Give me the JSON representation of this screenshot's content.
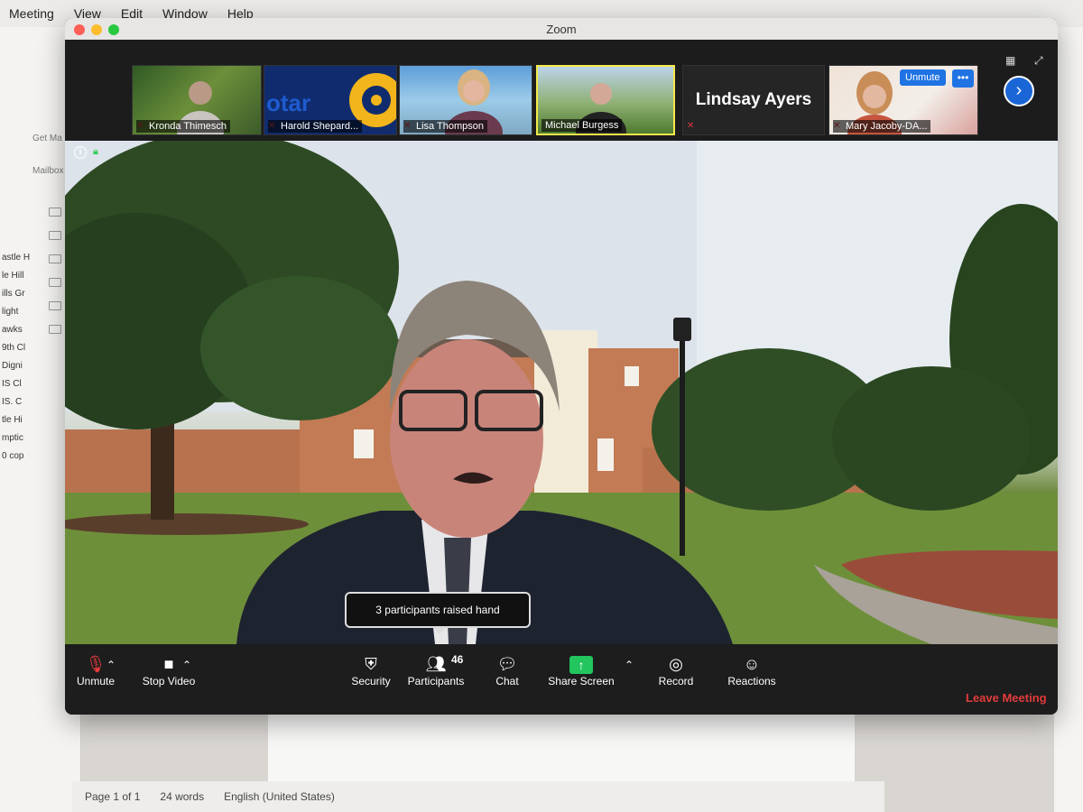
{
  "menubar": {
    "items": [
      "Meeting",
      "View",
      "Edit",
      "Window",
      "Help"
    ]
  },
  "window": {
    "title": "Zoom"
  },
  "participants": [
    {
      "name": "Kronda Thimesch"
    },
    {
      "name": "Harold Shepard..."
    },
    {
      "name": "Lisa Thompson"
    },
    {
      "name": "Michael Burgess"
    },
    {
      "name": "Lindsay Ayers"
    },
    {
      "name": "Mary Jacoby-DA..."
    }
  ],
  "thumb_actions": {
    "unmute": "Unmute",
    "more": "•••"
  },
  "tooltip": {
    "text": "3 participants raised hand"
  },
  "toolbar": {
    "unmute": "Unmute",
    "stop_video": "Stop Video",
    "security": "Security",
    "participants": "Participants",
    "participants_count": "46",
    "chat": "Chat",
    "share_screen": "Share Screen",
    "record": "Record",
    "reactions": "Reactions",
    "leave": "Leave Meeting"
  },
  "mail": {
    "get_mail": "Get Ma",
    "mailbox": "Mailbox",
    "rows": [
      "astle H",
      "le Hill",
      "ills Gr",
      "light",
      "awks",
      "9th Cl",
      "Digni",
      "IS Cl",
      "IS. C",
      "tle Hi",
      "mptic",
      "0 cop"
    ]
  },
  "word_status": {
    "page": "Page 1 of 1",
    "words": "24 words",
    "language": "English (United States)"
  },
  "colors": {
    "accent": "#1f73e3",
    "leave": "#e23b3b",
    "share": "#22c55e",
    "active_speaker": "#f4e94b"
  }
}
